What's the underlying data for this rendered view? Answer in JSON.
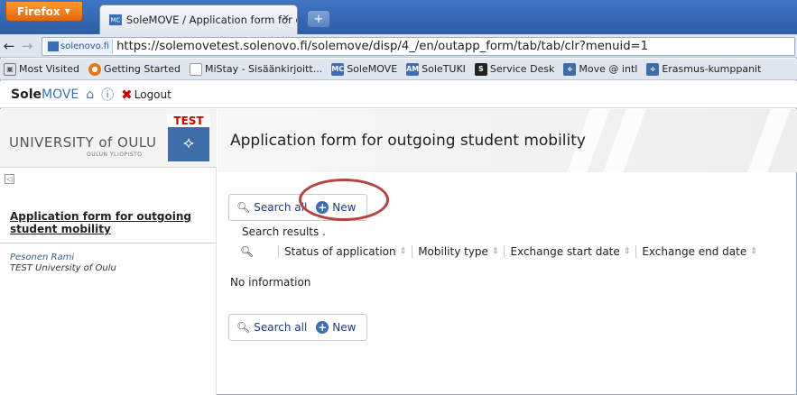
{
  "browser": {
    "app_menu": "Firefox",
    "tab_title": "SoleMOVE / Application form for out...",
    "identity": "solenovo.fi",
    "url": "https://solemovetest.solenovo.fi/solemove/disp/4_/en/outapp_form/tab/tab/clr?menuid=1",
    "bookmarks": [
      {
        "label": "Most Visited",
        "icon": "most-visited-icon"
      },
      {
        "label": "Getting Started",
        "icon": "firefox-icon"
      },
      {
        "label": "MiStay - Sisäänkirjoitt...",
        "icon": "page-icon"
      },
      {
        "label": "SoleMOVE",
        "icon": "mc-icon"
      },
      {
        "label": "SoleTUKI",
        "icon": "am-icon"
      },
      {
        "label": "Service Desk",
        "icon": "service-icon"
      },
      {
        "label": "Move @ intl",
        "icon": "oulu-icon"
      },
      {
        "label": "Erasmus-kumppanit",
        "icon": "oulu-icon"
      }
    ]
  },
  "app": {
    "brand_bold": "Sole",
    "brand_rest": "MOVE",
    "logout": "Logout"
  },
  "sidebar": {
    "test_label": "TEST",
    "university": "UNIVERSITY of OULU",
    "university_sub": "OULUN YLIOPISTO",
    "nav_link": "Application form for outgoing student mobility",
    "user_name": "Pesonen Rami",
    "user_org": "TEST University of Oulu"
  },
  "main": {
    "title": "Application form for outgoing student mobility",
    "search_all": "Search all",
    "new": "New",
    "search_results_label": "Search results .",
    "columns": [
      "Status of application",
      "Mobility type",
      "Exchange start date",
      "Exchange end date"
    ],
    "no_info": "No information"
  },
  "colors": {
    "accent": "#3c6db7",
    "test_red": "#cc0000",
    "highlight_circle": "#b5423f"
  }
}
